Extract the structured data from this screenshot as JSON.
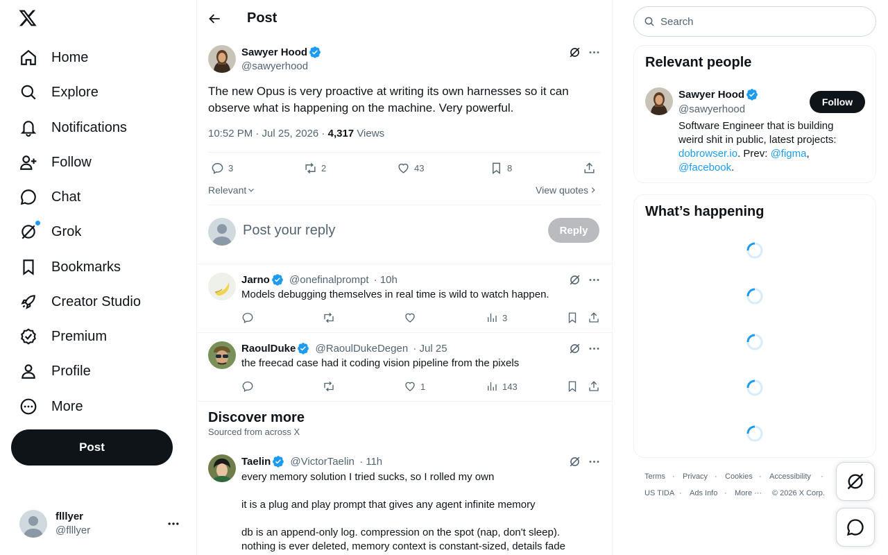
{
  "nav": {
    "items": [
      {
        "label": "Home",
        "icon": "home-icon"
      },
      {
        "label": "Explore",
        "icon": "search-icon"
      },
      {
        "label": "Notifications",
        "icon": "bell-icon"
      },
      {
        "label": "Follow",
        "icon": "person-add-icon"
      },
      {
        "label": "Chat",
        "icon": "chat-bubble-icon"
      },
      {
        "label": "Grok",
        "icon": "grok-icon"
      },
      {
        "label": "Bookmarks",
        "icon": "bookmark-icon"
      },
      {
        "label": "Creator Studio",
        "icon": "rocket-icon"
      },
      {
        "label": "Premium",
        "icon": "verified-badge-icon"
      },
      {
        "label": "Profile",
        "icon": "person-icon"
      },
      {
        "label": "More",
        "icon": "more-circle-icon"
      }
    ],
    "post_label": "Post"
  },
  "account": {
    "name": "flllyer",
    "handle": "@flllyer"
  },
  "header": {
    "title": "Post"
  },
  "post": {
    "author": "Sawyer Hood",
    "handle": "@sawyerhood",
    "text": "The new Opus is very proactive at writing its own harnesses so it can observe what is happening on the machine. Very powerful.",
    "time": "10:52 PM · Jul 25, 2026 · ",
    "views_count": "4,317",
    "views_label": " Views",
    "replies": "3",
    "reposts": "2",
    "likes": "43",
    "bookmarks": "8",
    "sort_label": "Relevant",
    "view_quotes": "View quotes"
  },
  "composer": {
    "placeholder": "Post your reply",
    "reply_label": "Reply"
  },
  "replies": [
    {
      "author": "Jarno",
      "handle": "@onefinalprompt",
      "time": "· 10h",
      "text": "Models debugging themselves in real time is wild to watch happen.",
      "replies": "",
      "reposts": "",
      "likes": "",
      "views": "3"
    },
    {
      "author": "RaoulDuke",
      "handle": "@RaoulDukeDegen",
      "time": "· Jul 25",
      "text": "the freecad case had it coding vision pipeline from the pixels",
      "replies": "",
      "reposts": "",
      "likes": "1",
      "views": "143"
    }
  ],
  "discover": {
    "title": "Discover more",
    "subtitle": "Sourced from across X",
    "post": {
      "author": "Taelin",
      "handle": "@VictorTaelin",
      "time": "· 11h",
      "line1": "every memory solution I tried sucks, so I rolled my own",
      "line2": "it is a plug and play prompt that gives any agent infinite memory",
      "line3": "db is an append-only log. compression on the spot (nap, don't sleep).",
      "line4": "nothing is ever deleted, memory context is constant-sized, details fade"
    }
  },
  "search": {
    "placeholder": "Search"
  },
  "relevant": {
    "title": "Relevant people",
    "name": "Sawyer Hood",
    "handle": "@sawyerhood",
    "follow_label": "Follow",
    "bio1": "Software Engineer that is building",
    "bio2": "weird shit in public, latest projects:",
    "link1": "dobrowser.io",
    "sep1": ". Prev: ",
    "link2": "@figma",
    "sep2": ",",
    "link3": "@facebook",
    "end": "."
  },
  "happening": {
    "title": "What’s happening"
  },
  "footer": {
    "terms": "Terms",
    "privacy": "Privacy",
    "cookies": "Cookies",
    "accessibility": "Accessibility",
    "ads": "US TIDA",
    "ads_info": "Ads Info",
    "more": "More ···",
    "copyright": "© 2026 X Corp."
  },
  "colors": {
    "accent": "#1d9bf0",
    "text": "#0f1419",
    "secondary": "#536471",
    "border": "#eff3f4"
  }
}
